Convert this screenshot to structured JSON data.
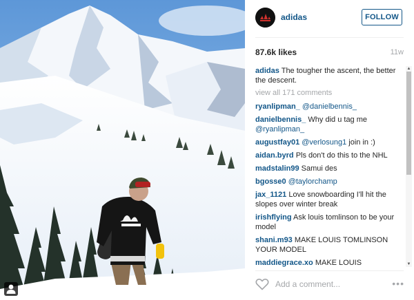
{
  "post": {
    "username": "adidas",
    "follow_label": "FOLLOW",
    "likes": "87.6k likes",
    "age": "11w",
    "caption": {
      "user": "adidas",
      "text": "The tougher the ascent, the better the descent."
    },
    "view_all": "view all 171 comments",
    "comments": [
      {
        "user": "ryanlipman_",
        "parts": [
          {
            "mention": "@danielbennis_"
          }
        ]
      },
      {
        "user": "danielbennis_",
        "parts": [
          {
            "text": "Why did u tag me "
          },
          {
            "mention": "@ryanlipman_"
          }
        ]
      },
      {
        "user": "augustfay01",
        "parts": [
          {
            "mention": "@verlosung1"
          },
          {
            "text": " join in :)"
          }
        ]
      },
      {
        "user": "aidan.byrd",
        "parts": [
          {
            "text": "Pls don't do this to the NHL"
          }
        ]
      },
      {
        "user": "madstalin99",
        "parts": [
          {
            "text": "Samui des"
          }
        ]
      },
      {
        "user": "bgosse0",
        "parts": [
          {
            "mention": "@taylorchamp"
          }
        ]
      },
      {
        "user": "jax_1121",
        "parts": [
          {
            "text": "Love snowboarding I'll hit the slopes over winter break"
          }
        ]
      },
      {
        "user": "irishflying",
        "parts": [
          {
            "text": "Ask louis tomlinson to be your model"
          }
        ]
      },
      {
        "user": "shani.m93",
        "parts": [
          {
            "text": "MAKE LOUIS TOMLINSON YOUR MODEL"
          }
        ]
      },
      {
        "user": "maddiegrace.xo",
        "parts": [
          {
            "text": "MAKE LOUIS TOMLINSON YOUR MODEL"
          }
        ]
      }
    ],
    "add_comment_placeholder": "Add a comment...",
    "more_label": "•••"
  },
  "colors": {
    "link": "#125688",
    "muted": "#a5a7aa",
    "text": "#262626"
  },
  "icons": {
    "like": "heart-icon",
    "tag": "user-tag-icon",
    "more": "more-options-icon"
  }
}
